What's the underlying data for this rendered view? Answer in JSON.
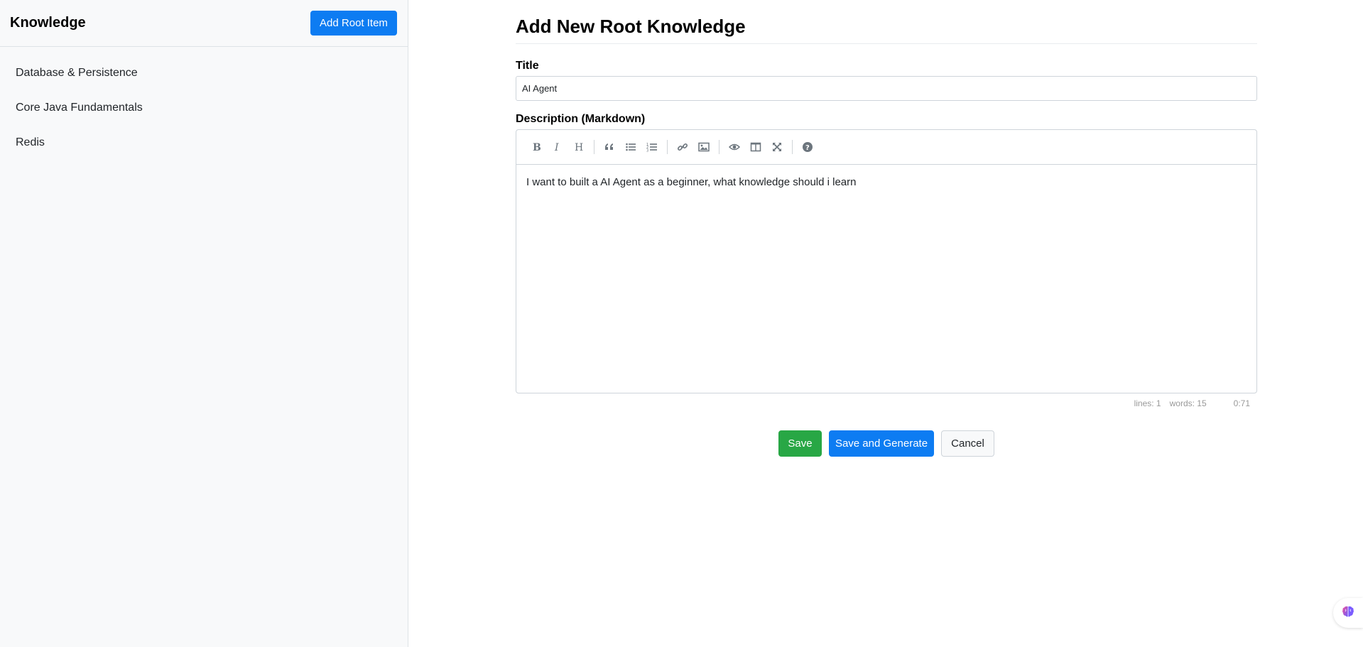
{
  "sidebar": {
    "title": "Knowledge",
    "add_button": "Add Root Item",
    "items": [
      {
        "label": "Database & Persistence"
      },
      {
        "label": "Core Java Fundamentals"
      },
      {
        "label": "Redis"
      }
    ]
  },
  "main": {
    "page_title": "Add New Root Knowledge",
    "title_label": "Title",
    "title_value": "AI Agent",
    "description_label": "Description (Markdown)",
    "description_text": "I want to built a AI Agent as a beginner, what knowledge should i learn",
    "toolbar_icons": [
      "bold-icon",
      "italic-icon",
      "heading-icon",
      "quote-icon",
      "unordered-list-icon",
      "ordered-list-icon",
      "link-icon",
      "image-icon",
      "preview-icon",
      "side-by-side-icon",
      "fullscreen-icon",
      "help-icon"
    ],
    "status": {
      "lines": "lines: 1",
      "words": "words: 15",
      "cursor": "0:71"
    },
    "buttons": {
      "save": "Save",
      "save_generate": "Save and Generate",
      "cancel": "Cancel"
    }
  },
  "colors": {
    "primary": "#0d7cf2",
    "success": "#28a745",
    "sidebar_bg": "#f8f9fa"
  },
  "floating": {
    "icon": "brain-icon"
  }
}
